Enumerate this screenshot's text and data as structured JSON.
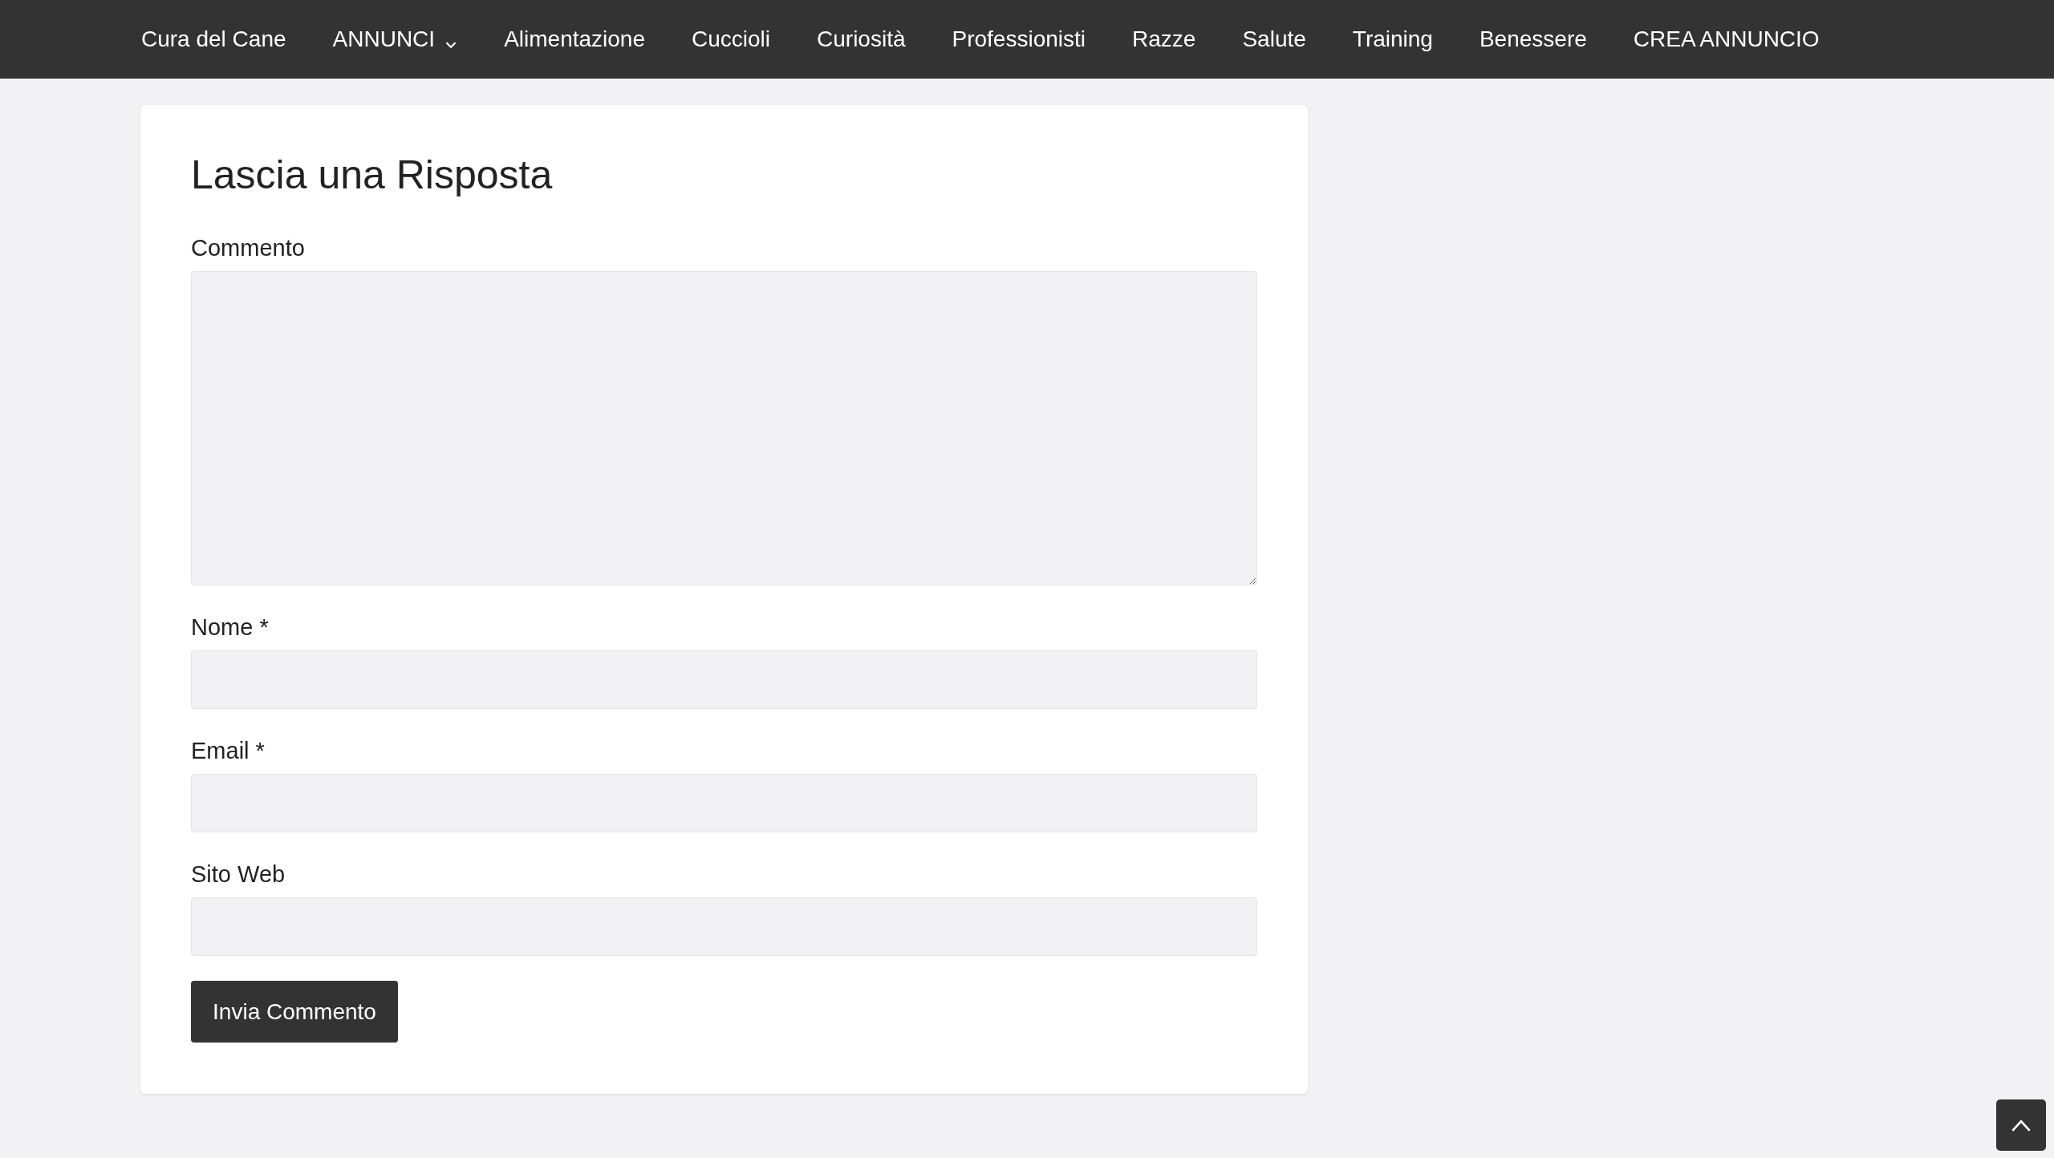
{
  "nav": {
    "items": [
      {
        "label": "Cura del Cane",
        "has_dropdown": false
      },
      {
        "label": "ANNUNCI",
        "has_dropdown": true
      },
      {
        "label": "Alimentazione",
        "has_dropdown": false
      },
      {
        "label": "Cuccioli",
        "has_dropdown": false
      },
      {
        "label": "Curiosità",
        "has_dropdown": false
      },
      {
        "label": "Professionisti",
        "has_dropdown": false
      },
      {
        "label": "Razze",
        "has_dropdown": false
      },
      {
        "label": "Salute",
        "has_dropdown": false
      },
      {
        "label": "Training",
        "has_dropdown": false
      },
      {
        "label": "Benessere",
        "has_dropdown": false
      },
      {
        "label": "CREA ANNUNCIO",
        "has_dropdown": false
      }
    ]
  },
  "comment_form": {
    "title": "Lascia una Risposta",
    "fields": [
      {
        "label": "Commento",
        "kind": "textarea"
      },
      {
        "label": "Nome *",
        "kind": "input"
      },
      {
        "label": "Email *",
        "kind": "input"
      },
      {
        "label": "Sito Web",
        "kind": "input"
      }
    ],
    "submit": "Invia Commento"
  }
}
